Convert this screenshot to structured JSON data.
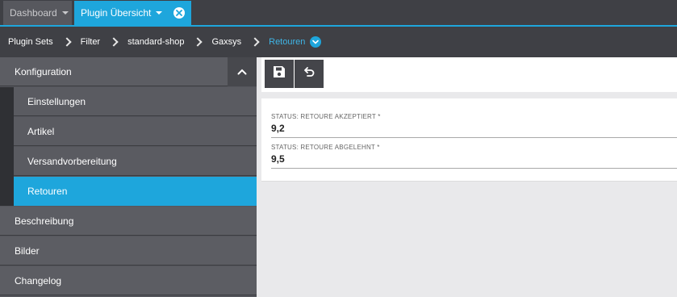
{
  "tabs": [
    {
      "label": "Dashboard"
    },
    {
      "label": "Plugin Übersicht"
    }
  ],
  "breadcrumb": [
    "Plugin Sets",
    "Filter",
    "standard-shop",
    "Gaxsys",
    "Retouren"
  ],
  "sidebar": {
    "items": [
      {
        "label": "Konfiguration"
      },
      {
        "label": "Einstellungen"
      },
      {
        "label": "Artikel"
      },
      {
        "label": "Versandvorbereitung"
      },
      {
        "label": "Retouren"
      },
      {
        "label": "Beschreibung"
      },
      {
        "label": "Bilder"
      },
      {
        "label": "Changelog"
      }
    ]
  },
  "form": {
    "fields": [
      {
        "label": "STATUS: RETOURE AKZEPTIERT *",
        "value": "9,2"
      },
      {
        "label": "STATUS: RETOURE ABGELEHNT *",
        "value": "9,5"
      }
    ]
  },
  "icons": {
    "save": "save-icon",
    "undo": "undo-icon",
    "close": "close-icon",
    "collapse": "chevron-up-icon",
    "dropdown": "chevron-down-icon"
  },
  "colors": {
    "accent": "#1ea6dc",
    "dark": "#3f4045"
  }
}
